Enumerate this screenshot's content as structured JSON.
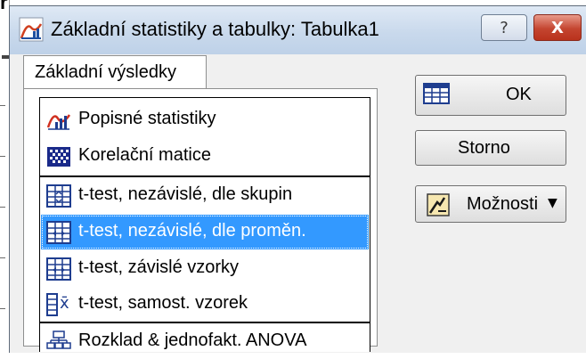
{
  "background": {
    "partial_text": "ř"
  },
  "dialog": {
    "title": "Základní statistiky a tabulky: Tabulka1",
    "help_label": "?",
    "close_label": "X"
  },
  "tabs": [
    {
      "label": "Základní výsledky",
      "active": true
    }
  ],
  "list": {
    "items": [
      {
        "label": "Popisné statistiky",
        "icon": "descriptive-stats-icon"
      },
      {
        "label": "Korelační matice",
        "icon": "correlation-matrix-icon"
      },
      {
        "label": "t-test, nezávislé, dle skupin",
        "icon": "ttest-groups-icon"
      },
      {
        "label": "t-test, nezávislé, dle proměn.",
        "icon": "ttest-variables-icon",
        "selected": true
      },
      {
        "label": "t-test, závislé vzorky",
        "icon": "ttest-dependent-icon"
      },
      {
        "label": "t-test, samost. vzorek",
        "icon": "ttest-single-icon",
        "icon_text": "x̄"
      },
      {
        "label": "Rozklad & jednofakt. ANOVA",
        "icon": "anova-icon"
      }
    ]
  },
  "buttons": {
    "ok_label": "OK",
    "cancel_label": "Storno",
    "options_label": "Možnosti",
    "options_arrow": "▼"
  },
  "colors": {
    "selection": "#3399ff",
    "close_button": "#c44530",
    "titlebar": "#c9d9ec"
  }
}
